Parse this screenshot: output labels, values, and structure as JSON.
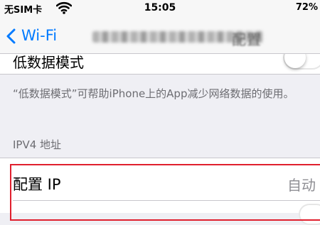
{
  "status_bar": {
    "carrier": "无SIM卡",
    "time": "15:05",
    "battery": "72%"
  },
  "nav": {
    "back_label": "Wi-Fi",
    "title_visible": "配置"
  },
  "low_data": {
    "label": "低数据模式",
    "toggle_on": false
  },
  "footer": {
    "text": "“低数据模式”可帮助iPhone上的App减少网络数据的使用。"
  },
  "ipv4": {
    "header": "IPV4 地址",
    "config_ip_label": "配置 IP",
    "config_ip_value": "自动"
  },
  "colors": {
    "accent": "#007aff",
    "highlight": "#e0202e",
    "secondary_text": "#6d6d72"
  }
}
